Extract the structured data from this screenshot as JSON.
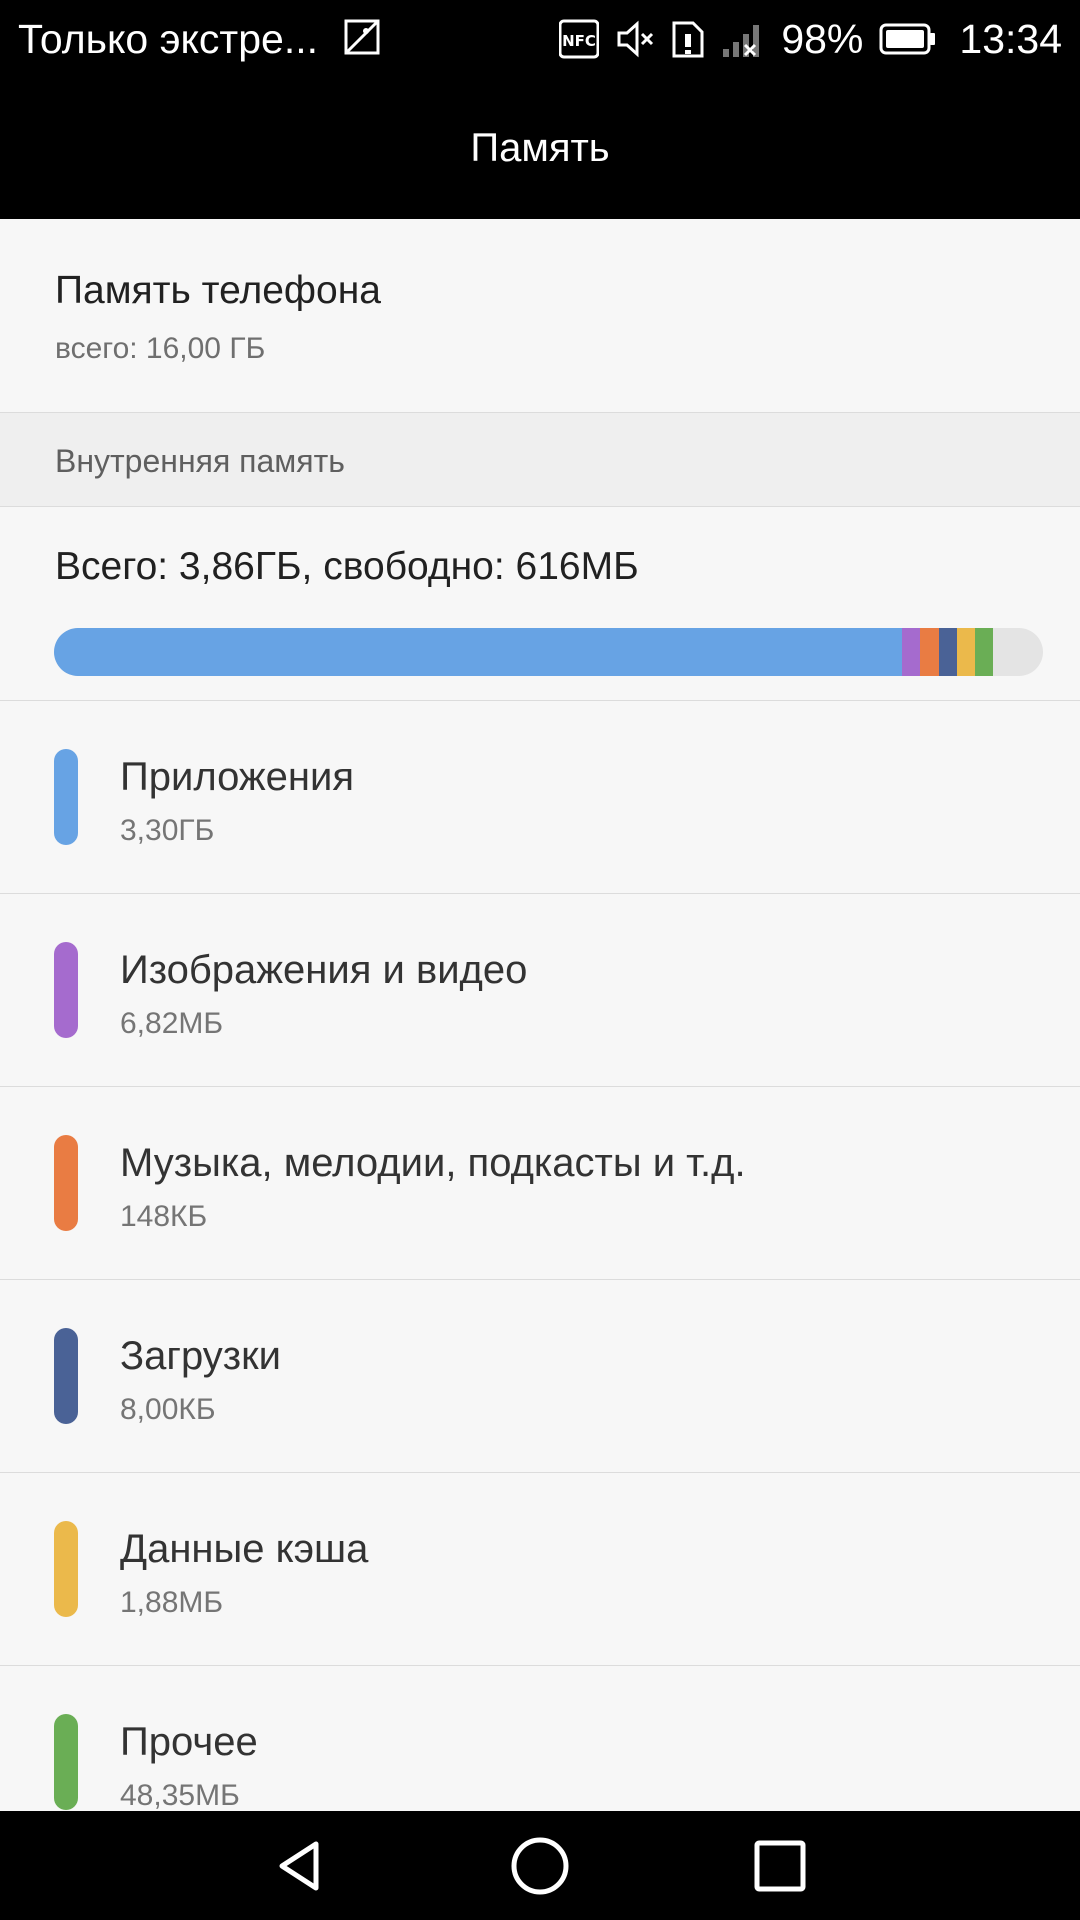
{
  "status_bar": {
    "carrier": "Только экстре...",
    "nfc_label": "NFC",
    "battery_percent": "98%",
    "time": "13:34",
    "icons": [
      "image-icon",
      "nfc-icon",
      "mute-icon",
      "sim-alert-icon",
      "no-signal-icon",
      "battery-icon"
    ]
  },
  "header": {
    "title": "Память"
  },
  "phone_storage": {
    "title": "Память телефона",
    "total": "всего: 16,00 ГБ"
  },
  "internal": {
    "section_label": "Внутренняя память",
    "summary": "Всего: 3,86ГБ, свободно: 616МБ",
    "bar_fill_fractions": [
      {
        "color": "#67a3e4",
        "fraction": 0.857
      },
      {
        "color": "#a56bce",
        "fraction": 0.019
      },
      {
        "color": "#e97c43",
        "fraction": 0.019
      },
      {
        "color": "#4a6296",
        "fraction": 0.018
      },
      {
        "color": "#ebb94b",
        "fraction": 0.018
      },
      {
        "color": "#6aae55",
        "fraction": 0.018
      }
    ],
    "bar_empty_color": "#e4e4e4"
  },
  "categories": [
    {
      "label": "Приложения",
      "size": "3,30ГБ",
      "color": "#67a3e4"
    },
    {
      "label": "Изображения и видео",
      "size": "6,82МБ",
      "color": "#a56bce"
    },
    {
      "label": "Музыка, мелодии, подкасты и т.д.",
      "size": "148КБ",
      "color": "#e97c43"
    },
    {
      "label": "Загрузки",
      "size": "8,00КБ",
      "color": "#4a6296"
    },
    {
      "label": "Данные кэша",
      "size": "1,88МБ",
      "color": "#ebb94b"
    },
    {
      "label": "Прочее",
      "size": "48,35МБ",
      "color": "#6aae55"
    }
  ],
  "nav": {
    "icons": [
      "back-icon",
      "home-icon",
      "recents-icon"
    ]
  }
}
